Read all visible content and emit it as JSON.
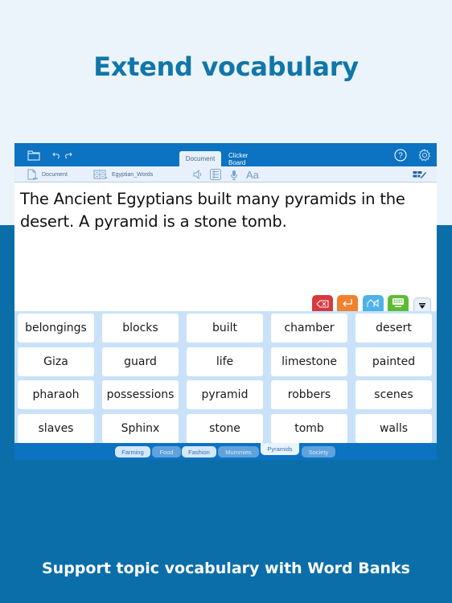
{
  "headline": "Extend vocabulary",
  "footer": "Support topic vocabulary with Word Banks",
  "colors": {
    "headline": "#1176a8",
    "page_bg_top": "#ebf3fb",
    "page_bg_bottom": "#0b6ea8",
    "titlebar": "#0c72c2",
    "grid_bg": "#c9e2f9",
    "delete_button": "#d63a3f",
    "enter_button": "#f0812f",
    "speak_button": "#4fb2e8",
    "keyboard_button": "#5dbb33"
  },
  "titlebar": {
    "icons": [
      "folder-icon",
      "undo-icon",
      "redo-icon",
      "help-icon",
      "settings-icon"
    ],
    "tabs": [
      {
        "label": "Document",
        "active": true
      },
      {
        "label": "Clicker Board",
        "active": false
      }
    ]
  },
  "toolbar": {
    "document_label": "Document",
    "wordbank_label": "Egyptian_Words",
    "icons": [
      "document-icon",
      "word-bank-icon",
      "speaker-icon",
      "list-icon",
      "microphone-icon",
      "font-icon",
      "edit-grid-icon"
    ],
    "font_label": "Aa"
  },
  "document": {
    "text": "The Ancient Egyptians built many pyramids in the desert. A pyramid is a stone tomb."
  },
  "action_buttons": [
    {
      "name": "delete",
      "icon": "backspace-icon"
    },
    {
      "name": "enter",
      "icon": "return-icon"
    },
    {
      "name": "speak",
      "icon": "speak-icon"
    },
    {
      "name": "keyboard",
      "icon": "keyboard-icon"
    },
    {
      "name": "collapse",
      "icon": "collapse-down-icon"
    }
  ],
  "word_grid": [
    [
      "belongings",
      "blocks",
      "built",
      "chamber",
      "desert"
    ],
    [
      "Giza",
      "guard",
      "life",
      "limestone",
      "painted"
    ],
    [
      "pharaoh",
      "possessions",
      "pyramid",
      "robbers",
      "scenes"
    ],
    [
      "slaves",
      "Sphinx",
      "stone",
      "tomb",
      "walls"
    ]
  ],
  "word_bank_tabs": [
    {
      "label": "Farming",
      "selected": false
    },
    {
      "label": "Food",
      "selected": false
    },
    {
      "label": "Fashion",
      "selected": false
    },
    {
      "label": "Mummies",
      "selected": false
    },
    {
      "label": "Pyramids",
      "selected": true
    },
    {
      "label": "Society",
      "selected": false
    }
  ]
}
